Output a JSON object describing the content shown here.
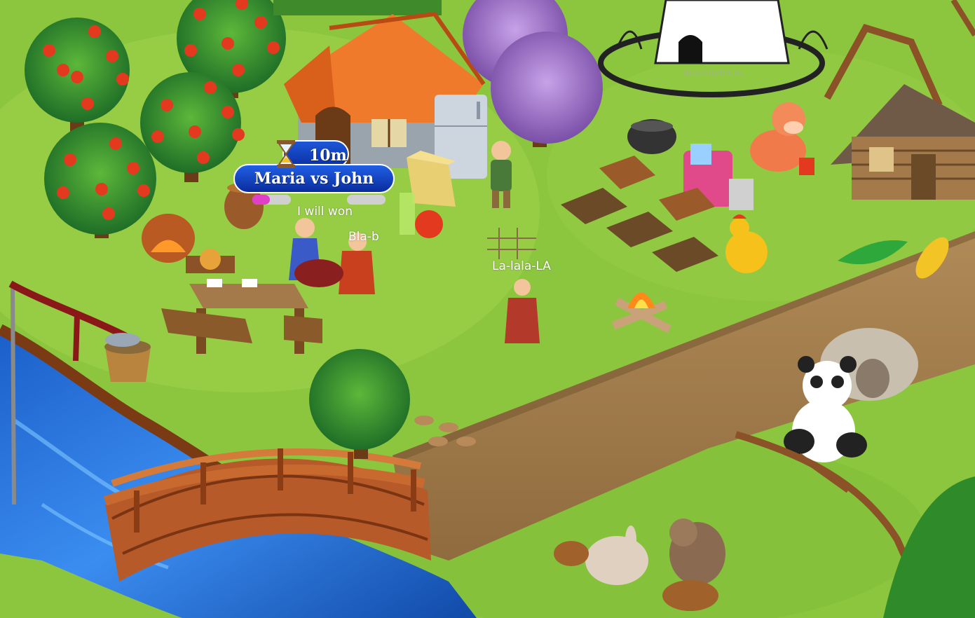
{
  "match": {
    "timer": "10m",
    "title": "Maria vs John"
  },
  "chat": {
    "player1": "I will won",
    "player2": "Bla-b",
    "player3": "La-lala-LA"
  },
  "watermark": "depositphotos",
  "colors": {
    "grass": "#8cc63f",
    "path": "#a07c4d",
    "river": "#1f6fd1",
    "badge_blue": "#1646c8",
    "roof_orange": "#f07a2c",
    "wood": "#9a5a2a"
  },
  "icons": {
    "timer": "hourglass-icon",
    "score_left": "star-progress-icon",
    "score_right": "star-progress-icon"
  }
}
